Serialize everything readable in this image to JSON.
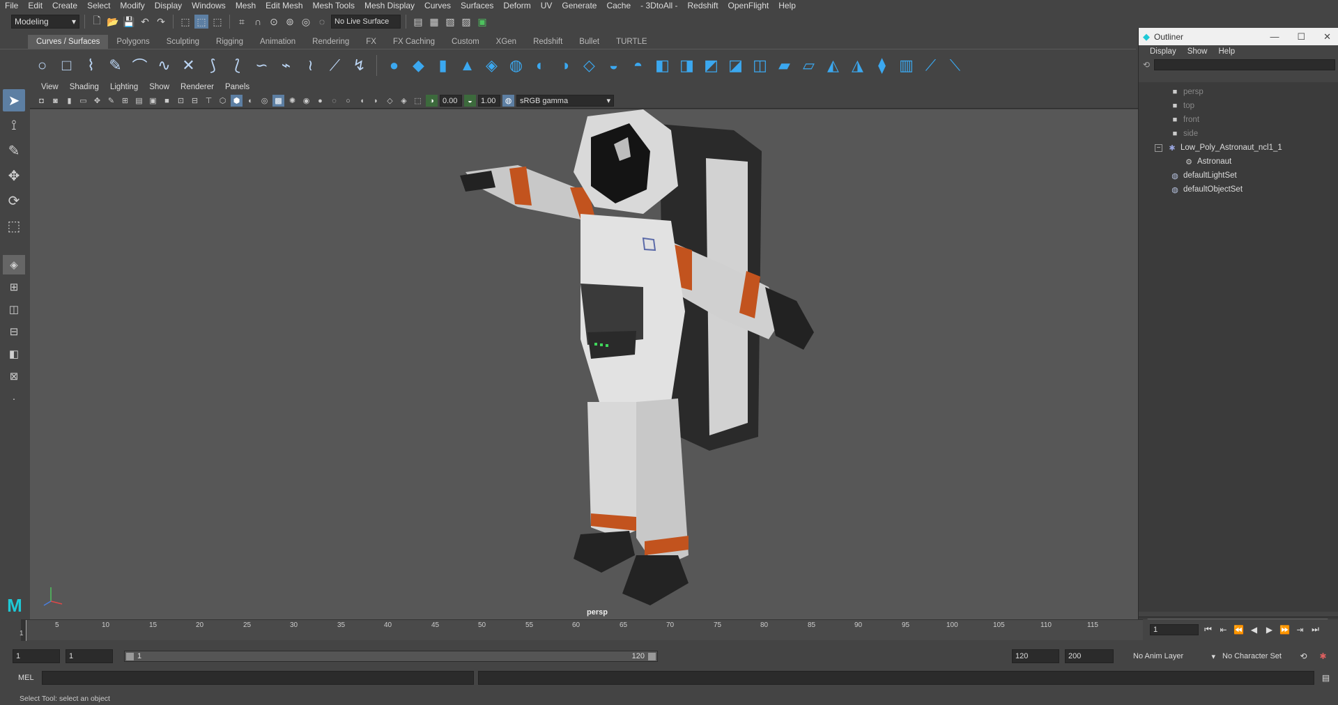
{
  "menubar": [
    "File",
    "Edit",
    "Create",
    "Select",
    "Modify",
    "Display",
    "Windows",
    "Mesh",
    "Edit Mesh",
    "Mesh Tools",
    "Mesh Display",
    "Curves",
    "Surfaces",
    "Deform",
    "UV",
    "Generate",
    "Cache",
    "- 3DtoAll -",
    "Redshift",
    "OpenFlight",
    "Help"
  ],
  "statusline": {
    "workspace": "Modeling",
    "live_surface": "No Live Surface"
  },
  "shelf_tabs": [
    "Curves / Surfaces",
    "Polygons",
    "Sculpting",
    "Rigging",
    "Animation",
    "Rendering",
    "FX",
    "FX Caching",
    "Custom",
    "XGen",
    "Redshift",
    "Bullet",
    "TURTLE"
  ],
  "active_shelf_tab": "Curves / Surfaces",
  "viewport": {
    "menus": [
      "View",
      "Shading",
      "Lighting",
      "Show",
      "Renderer",
      "Panels"
    ],
    "exposure": "0.00",
    "gamma": "1.00",
    "color_space": "sRGB gamma",
    "camera_label": "persp"
  },
  "outliner": {
    "title": "Outliner",
    "menus": [
      "Display",
      "Show",
      "Help"
    ],
    "nodes": [
      {
        "label": "persp",
        "icon": "camera-icon",
        "dim": true
      },
      {
        "label": "top",
        "icon": "camera-icon",
        "dim": true
      },
      {
        "label": "front",
        "icon": "camera-icon",
        "dim": true
      },
      {
        "label": "side",
        "icon": "camera-icon",
        "dim": true
      },
      {
        "label": "Low_Poly_Astronaut_ncl1_1",
        "icon": "group-icon",
        "dim": false
      },
      {
        "label": "Astronaut",
        "icon": "mesh-icon",
        "dim": false
      },
      {
        "label": "defaultLightSet",
        "icon": "set-icon",
        "dim": false
      },
      {
        "label": "defaultObjectSet",
        "icon": "set-icon",
        "dim": false
      }
    ]
  },
  "timeslider": {
    "ticks": [
      "5",
      "10",
      "15",
      "20",
      "25",
      "30",
      "35",
      "40",
      "45",
      "50",
      "55",
      "60",
      "65",
      "70",
      "75",
      "80",
      "85",
      "90",
      "95",
      "100",
      "105",
      "110",
      "115"
    ],
    "playhead_frame": "1",
    "current_frame": "1"
  },
  "rangeslider": {
    "start": "1",
    "playback_start": "1",
    "range_start": "1",
    "range_end": "120",
    "playback_end": "120",
    "end": "200",
    "anim_layer": "No Anim Layer",
    "character_set": "No Character Set"
  },
  "cmdline": {
    "label": "MEL"
  },
  "helpline": {
    "text": "Select Tool: select an object"
  }
}
